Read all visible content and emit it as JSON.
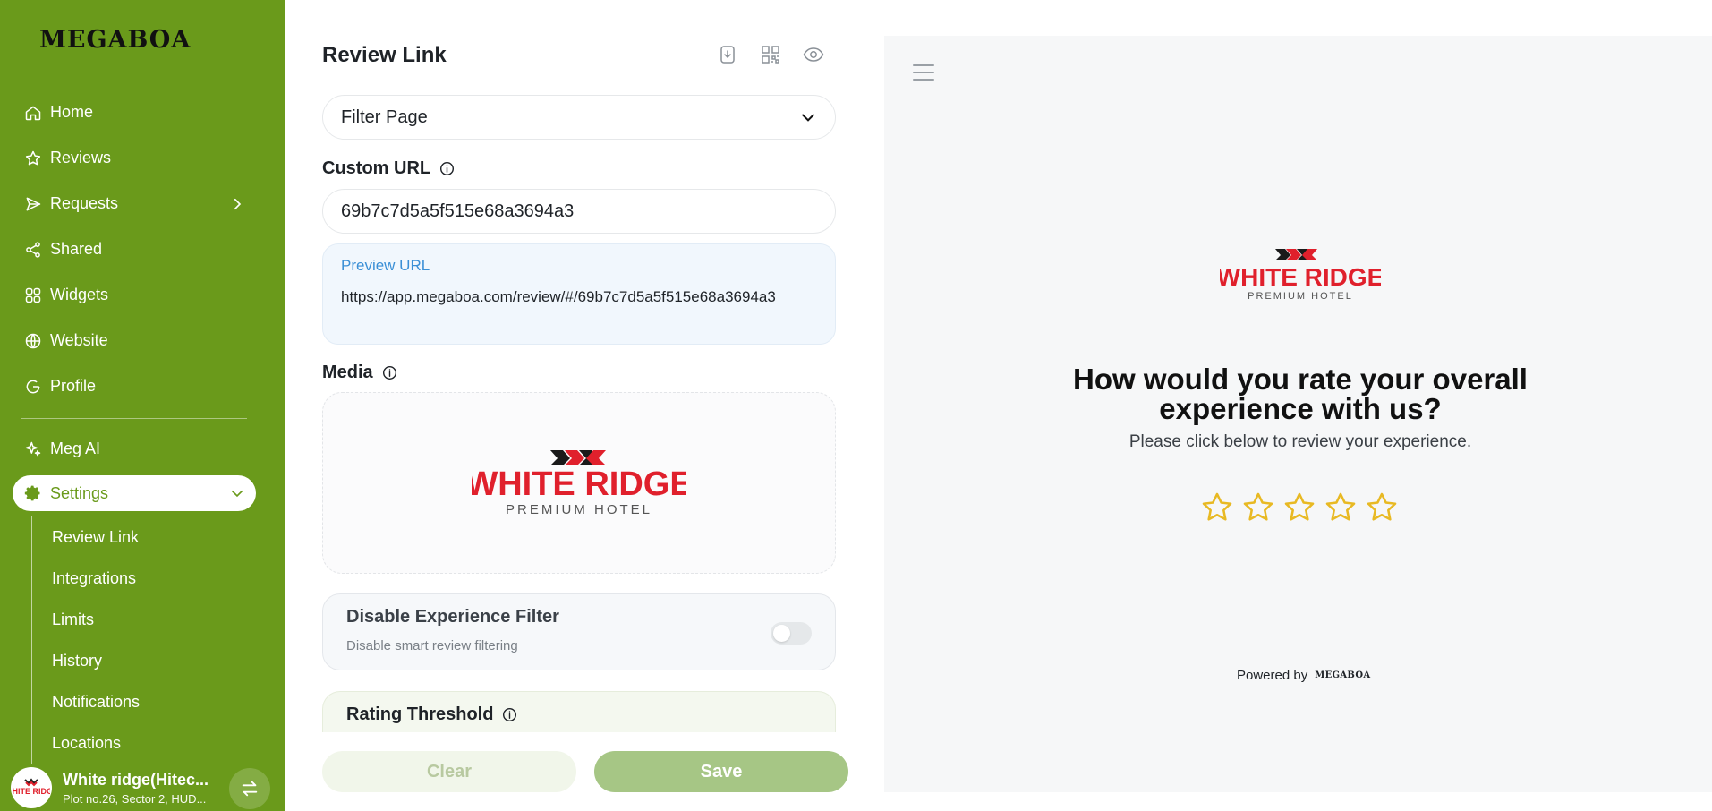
{
  "brand": {
    "name": "MEGABOA"
  },
  "sidebar": {
    "items": [
      {
        "label": "Home",
        "icon": "home-icon"
      },
      {
        "label": "Reviews",
        "icon": "star-icon"
      },
      {
        "label": "Requests",
        "icon": "send-icon"
      },
      {
        "label": "Shared",
        "icon": "share-icon"
      },
      {
        "label": "Widgets",
        "icon": "widgets-icon"
      },
      {
        "label": "Website",
        "icon": "globe-icon"
      },
      {
        "label": "Profile",
        "icon": "profile-icon"
      },
      {
        "label": "Meg AI",
        "icon": "sparkle-icon"
      },
      {
        "label": "Settings",
        "icon": "gear-icon"
      }
    ],
    "settings_sub": [
      "Review Link",
      "Integrations",
      "Limits",
      "History",
      "Notifications",
      "Locations"
    ],
    "account": {
      "name": "White ridge(Hitec...",
      "address": "Plot no.26, Sector 2, HUD..."
    }
  },
  "editor": {
    "title": "Review Link",
    "page_select": "Filter Page",
    "custom_url_label": "Custom URL",
    "custom_url_value": "69b7c7d5a5f515e68a3694a3",
    "preview_label": "Preview URL",
    "preview_url": "https://app.megaboa.com/review/#/69b7c7d5a5f515e68a3694a3",
    "media_label": "Media",
    "disable_filter_title": "Disable Experience Filter",
    "disable_filter_sub": "Disable smart review filtering",
    "disable_filter_on": false,
    "threshold_title": "Rating Threshold",
    "clear_label": "Clear",
    "save_label": "Save"
  },
  "logo": {
    "line1": "WHITE RIDGE",
    "line2": "PREMIUM HOTEL"
  },
  "preview": {
    "question": "How would you rate your overall experience with us?",
    "subtitle": "Please click below to review your experience.",
    "stars": 5,
    "powered_by": "Powered by",
    "powered_brand": "MEGABOA"
  },
  "colors": {
    "sidebar": "#6a9a1b",
    "accent_blue": "#3a8fd6",
    "logo_red": "#e0202c",
    "star": "#e8b923"
  }
}
